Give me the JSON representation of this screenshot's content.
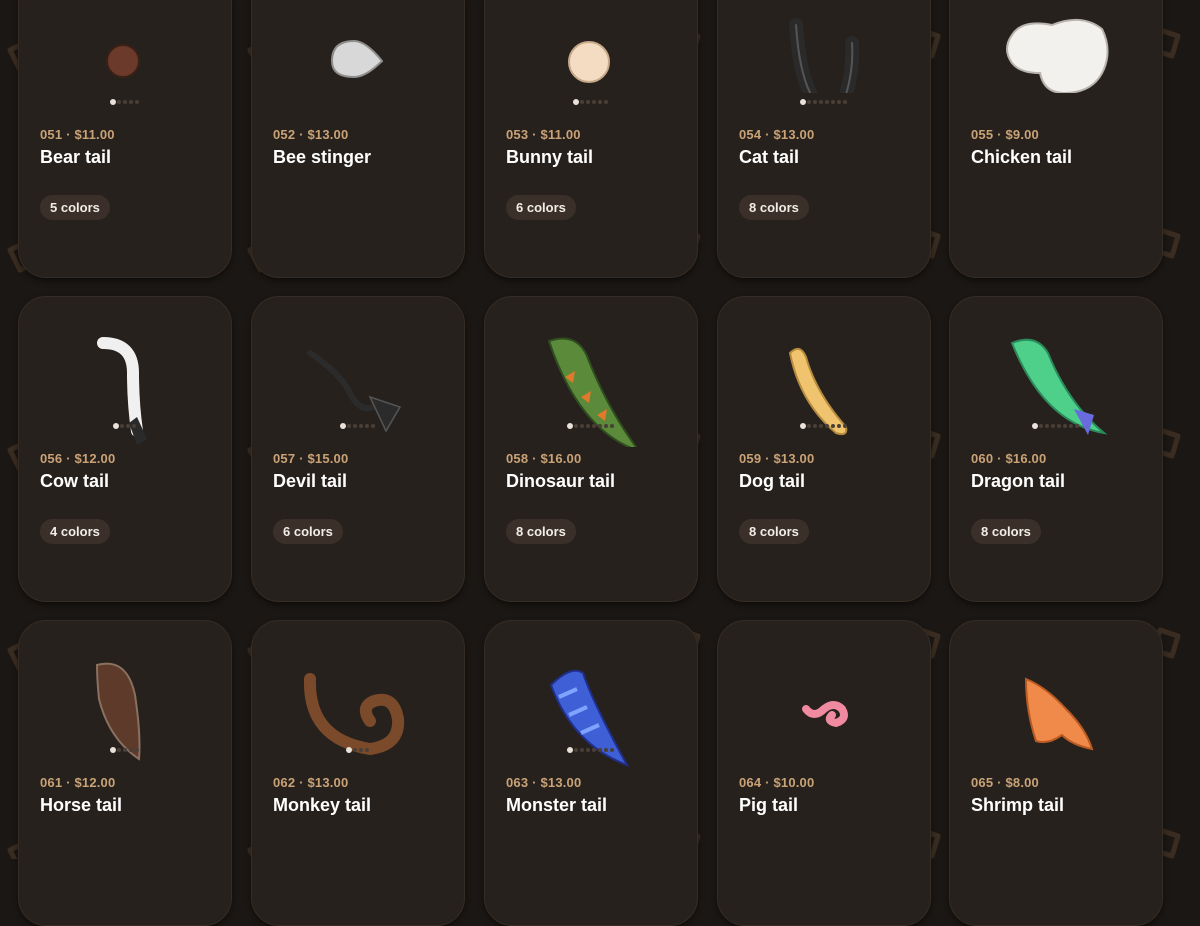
{
  "products": [
    {
      "code": "051",
      "price": "$11.00",
      "name": "Bear tail",
      "colors": "5 colors",
      "icon": "bear-tail-icon",
      "color_count": 5
    },
    {
      "code": "052",
      "price": "$13.00",
      "name": "Bee stinger",
      "colors": "",
      "icon": "bee-stinger-icon",
      "color_count": 0
    },
    {
      "code": "053",
      "price": "$11.00",
      "name": "Bunny tail",
      "colors": "6 colors",
      "icon": "bunny-tail-icon",
      "color_count": 6
    },
    {
      "code": "054",
      "price": "$13.00",
      "name": "Cat tail",
      "colors": "8 colors",
      "icon": "cat-tail-icon",
      "color_count": 8
    },
    {
      "code": "055",
      "price": "$9.00",
      "name": "Chicken tail",
      "colors": "",
      "icon": "chicken-tail-icon",
      "color_count": 0
    },
    {
      "code": "056",
      "price": "$12.00",
      "name": "Cow tail",
      "colors": "4 colors",
      "icon": "cow-tail-icon",
      "color_count": 4
    },
    {
      "code": "057",
      "price": "$15.00",
      "name": "Devil tail",
      "colors": "6 colors",
      "icon": "devil-tail-icon",
      "color_count": 6
    },
    {
      "code": "058",
      "price": "$16.00",
      "name": "Dinosaur tail",
      "colors": "8 colors",
      "icon": "dinosaur-tail-icon",
      "color_count": 8
    },
    {
      "code": "059",
      "price": "$13.00",
      "name": "Dog tail",
      "colors": "8 colors",
      "icon": "dog-tail-icon",
      "color_count": 8
    },
    {
      "code": "060",
      "price": "$16.00",
      "name": "Dragon tail",
      "colors": "8 colors",
      "icon": "dragon-tail-icon",
      "color_count": 8
    },
    {
      "code": "061",
      "price": "$12.00",
      "name": "Horse tail",
      "colors": "",
      "icon": "horse-tail-icon",
      "color_count": 5
    },
    {
      "code": "062",
      "price": "$13.00",
      "name": "Monkey tail",
      "colors": "",
      "icon": "monkey-tail-icon",
      "color_count": 4
    },
    {
      "code": "063",
      "price": "$13.00",
      "name": "Monster tail",
      "colors": "",
      "icon": "monster-tail-icon",
      "color_count": 8
    },
    {
      "code": "064",
      "price": "$10.00",
      "name": "Pig tail",
      "colors": "",
      "icon": "pig-tail-icon",
      "color_count": 0
    },
    {
      "code": "065",
      "price": "$8.00",
      "name": "Shrimp tail",
      "colors": "",
      "icon": "shrimp-tail-icon",
      "color_count": 0
    }
  ],
  "separator": " · "
}
